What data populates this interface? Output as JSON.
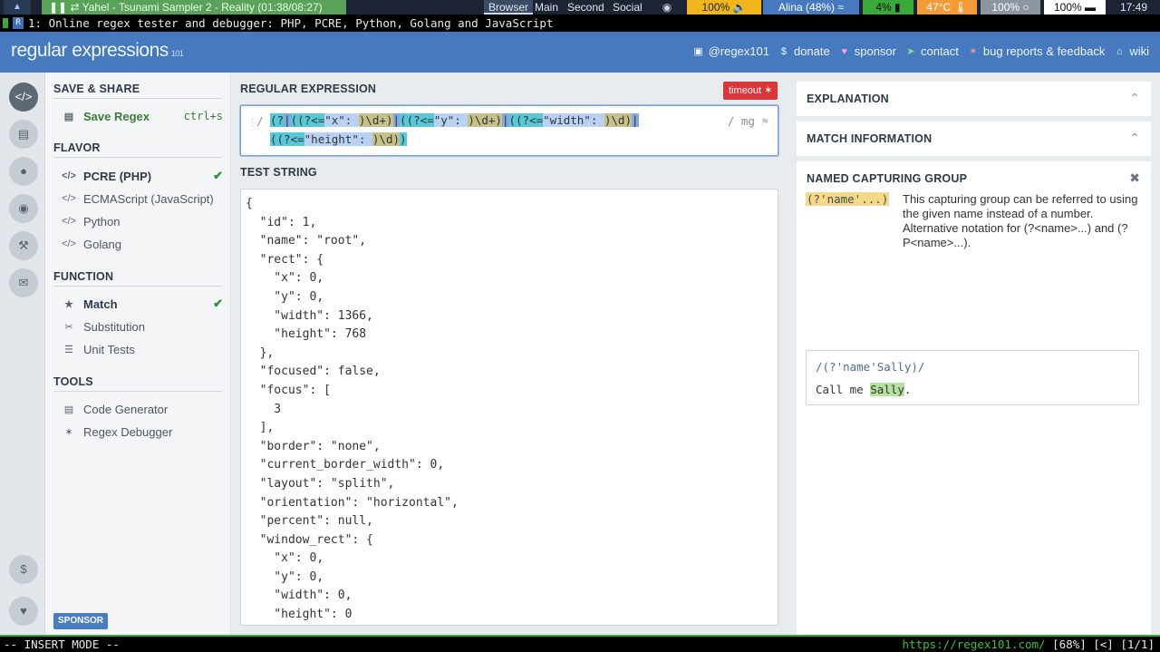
{
  "sysbar": {
    "media_title": "Yahel - Tsunami Sampler 2 - Reality (01:38/08:27)",
    "workspaces": [
      "Browser",
      "Main",
      "Second",
      "Social"
    ],
    "volume": "100%",
    "wifi": "Alina (48%)",
    "battery": "4%",
    "temp": "47°C",
    "brightness": "100%",
    "mem": "100%",
    "clock": "17:49",
    "colors": {
      "volume": "#f0b61c",
      "wifi": "#4679bd",
      "battery": "#3aa83a",
      "temp": "#f29b38",
      "bright": "#8c96a3",
      "mem": "#ffffff"
    }
  },
  "term": {
    "title_line": "1: Online regex tester and debugger: PHP, PCRE, Python, Golang and JavaScript"
  },
  "header": {
    "brand": "regular expressions",
    "brand_sub": "101",
    "nav": [
      {
        "label": "@regex101",
        "icon": "twitter-icon"
      },
      {
        "label": "donate",
        "icon": "dollar-icon"
      },
      {
        "label": "sponsor",
        "icon": "heart-icon"
      },
      {
        "label": "contact",
        "icon": "paper-plane-icon"
      },
      {
        "label": "bug reports & feedback",
        "icon": "bug-icon"
      },
      {
        "label": "wiki",
        "icon": "bank-icon"
      }
    ]
  },
  "menu": {
    "save_share": "SAVE & SHARE",
    "save_regex": "Save Regex",
    "save_kbd": "ctrl+s",
    "flavor": "FLAVOR",
    "flavors": [
      "PCRE (PHP)",
      "ECMAScript (JavaScript)",
      "Python",
      "Golang"
    ],
    "function": "FUNCTION",
    "functions": [
      "Match",
      "Substitution",
      "Unit Tests"
    ],
    "tools": "TOOLS",
    "tools_items": [
      "Code Generator",
      "Regex Debugger"
    ],
    "sponsor_btn": "SPONSOR"
  },
  "regex": {
    "section_title": "REGULAR EXPRESSION",
    "timeout": "timeout",
    "delimiter": "/",
    "flags": "/ mg",
    "line1": {
      "open": "(?",
      "pipe1": "|",
      "g1_open": "((?<=",
      "x_lit": "\"x\": ",
      "d1": ")\\d+)",
      "pipe2": "|",
      "g2_open": "((?<=",
      "y_lit": "\"y\": ",
      "d2": ")\\d+)",
      "pipe3": "|",
      "g3_open": "((?<=",
      "w_lit": "\"width\": ",
      "d3": ")\\d)",
      "pipe4": "|"
    },
    "line2": {
      "g4_open": "((?<=",
      "h_lit": "\"height\": ",
      "d4": ")\\d)",
      "close": ")"
    }
  },
  "test": {
    "section_title": "TEST STRING",
    "text": "{\n  \"id\": 1,\n  \"name\": \"root\",\n  \"rect\": {\n    \"x\": 0,\n    \"y\": 0,\n    \"width\": 1366,\n    \"height\": 768\n  },\n  \"focused\": false,\n  \"focus\": [\n    3\n  ],\n  \"border\": \"none\",\n  \"current_border_width\": 0,\n  \"layout\": \"splith\",\n  \"orientation\": \"horizontal\",\n  \"percent\": null,\n  \"window_rect\": {\n    \"x\": 0,\n    \"y\": 0,\n    \"width\": 0,\n    \"height\": 0"
  },
  "right": {
    "explanation": "EXPLANATION",
    "match_info": "MATCH INFORMATION",
    "ncg_title": "NAMED CAPTURING GROUP",
    "ncg_code": "(?'name'...)",
    "ncg_desc": "This capturing group can be referred to using the given name instead of a number. Alternative notation for (?<name>...) and (?P<name>...).",
    "example_regex": "/(?'name'Sally)/",
    "example_prefix": "Call me ",
    "example_match": "Sally",
    "example_suffix": "."
  },
  "status": {
    "mode": "-- INSERT MODE --",
    "url": "https://regex101.com/",
    "info": " [68%] [<] [1/1]"
  }
}
